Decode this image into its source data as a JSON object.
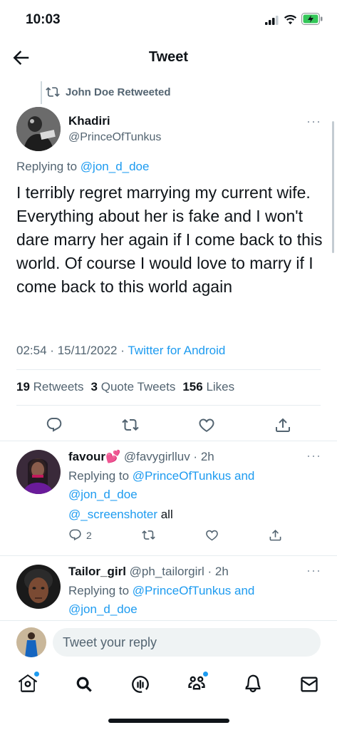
{
  "status_bar": {
    "time": "10:03"
  },
  "header": {
    "title": "Tweet"
  },
  "retweet_context": {
    "label": "John Doe Retweeted"
  },
  "tweet": {
    "author_name": "Khadiri",
    "author_handle": "@PrinceOfTunkus",
    "replying_prefix": "Replying to",
    "replying_handle": "@jon_d_doe",
    "text": "I terribly regret marrying my current wife. Everything about her is fake and I won't dare marry her again if I come back to this world. Of course I would love to marry if I come back to this world again",
    "time": "02:54",
    "date": "15/11/2022",
    "source": "Twitter for Android",
    "retweets_count": "19",
    "retweets_label": "Retweets",
    "quotes_count": "3",
    "quotes_label": "Quote Tweets",
    "likes_count": "156",
    "likes_label": "Likes"
  },
  "replies": [
    {
      "author_name": "favour💕",
      "author_handle": "@favygirlluv",
      "age": "2h",
      "replying_prefix": "Replying to",
      "replying_handles_line1": "@PrinceOfTunkus and",
      "replying_handles_line2": "@jon_d_doe",
      "mention": "@_screenshoter",
      "text_suffix": " all",
      "reply_count": "2"
    },
    {
      "author_name": "Tailor_girl",
      "author_handle": "@ph_tailorgirl",
      "age": "2h",
      "replying_prefix": "Replying to",
      "replying_handles_line1": "@PrinceOfTunkus and",
      "replying_handles_line2": "@jon_d_doe"
    }
  ],
  "compose": {
    "placeholder": "Tweet your reply"
  },
  "colors": {
    "accent": "#1d9bf0",
    "text": "#0f1419",
    "secondary": "#536471",
    "battery": "#34c759"
  },
  "icons": [
    "back-arrow-icon",
    "retweet-icon",
    "reply-icon",
    "like-icon",
    "share-icon",
    "home-icon",
    "search-icon",
    "spaces-icon",
    "communities-icon",
    "notifications-icon",
    "messages-icon"
  ]
}
